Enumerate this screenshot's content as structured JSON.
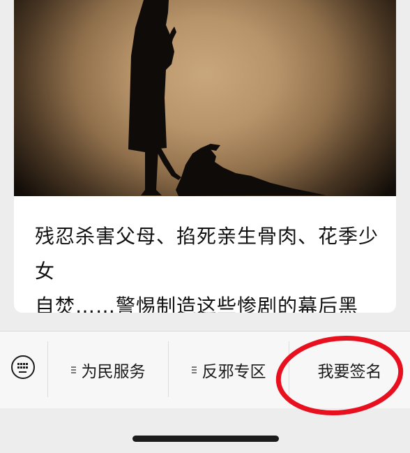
{
  "article": {
    "cover_image": "silhouette-woman-reaching-towards-standing-figure",
    "title_line1": "残忍杀害父母、掐死亲生骨肉、花季少女",
    "title_line2": "自焚……警惕制造这些惨剧的幕后黑手！"
  },
  "menu": {
    "keyboard_icon": "keyboard-icon",
    "items": [
      {
        "label": "为民服务",
        "has_submenu": true
      },
      {
        "label": "反邪专区",
        "has_submenu": true
      },
      {
        "label": "我要签名",
        "has_submenu": false
      }
    ]
  },
  "annotation": {
    "highlight_color": "#e8101f",
    "highlighted_item": "我要签名"
  },
  "colors": {
    "background": "#ededed",
    "card": "#ffffff",
    "menu_bar": "#f7f7f7",
    "text": "#111111"
  }
}
